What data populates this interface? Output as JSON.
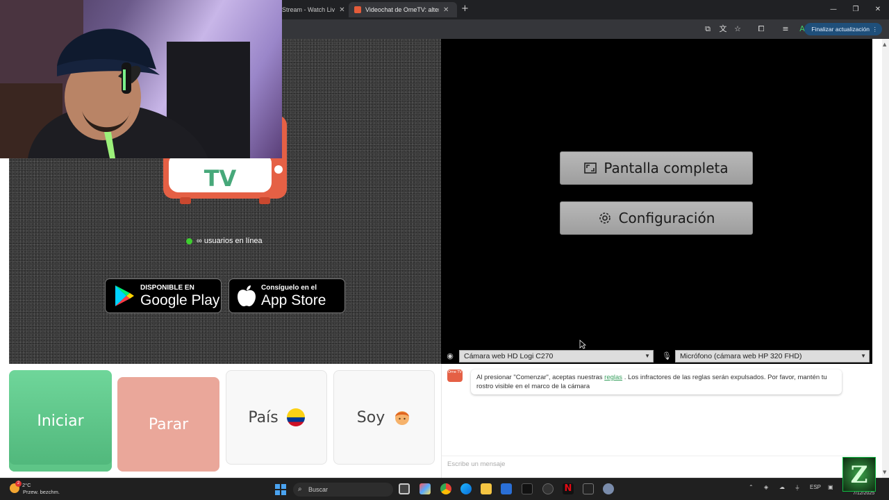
{
  "browser": {
    "tabs": [
      {
        "label": "Stream - Watch Liv",
        "active": false
      },
      {
        "label": "Videochat de OmeTV: alternati",
        "active": true
      }
    ],
    "update_button": "Finalizar actualización",
    "profile_initial": "A"
  },
  "left_panel": {
    "logo_text": "TV",
    "online_text": "∞ usuarios en línea",
    "google_play": {
      "small": "DISPONIBLE EN",
      "big": "Google Play"
    },
    "app_store": {
      "small": "Consíguelo en el",
      "big": "App Store"
    }
  },
  "right_panel": {
    "fullscreen_label": "Pantalla completa",
    "settings_label": "Configuración",
    "camera_select": "Cámara web HD Logi C270",
    "mic_select": "Micrófono (cámara web HP 320 FHD)"
  },
  "buttons": {
    "start": "Iniciar",
    "stop": "Parar",
    "country": "País",
    "soy": "Soy"
  },
  "chat": {
    "logo_text": "Ome TV",
    "message_before": "Al presionar \"Comenzar\", aceptas nuestras",
    "message_link": "reglas",
    "message_after": ". Los infractores de las reglas serán expulsados. Por favor, mantén tu rostro visible en el marco de la cámara",
    "input_placeholder": "Escribe un mensaje"
  },
  "taskbar": {
    "weather_temp": "2°C",
    "weather_desc": "Przew. bezchm.",
    "weather_badge": "2",
    "search_label": "Buscar",
    "language": "ESP",
    "date": "7/12/2025",
    "corner_logo": "Z"
  },
  "colors": {
    "start_green": "#5ec587",
    "stop_red": "#eaa79a",
    "online_dot": "#3ecf2f",
    "tv_red": "#e56045",
    "tv_text_green": "#47a87a"
  }
}
